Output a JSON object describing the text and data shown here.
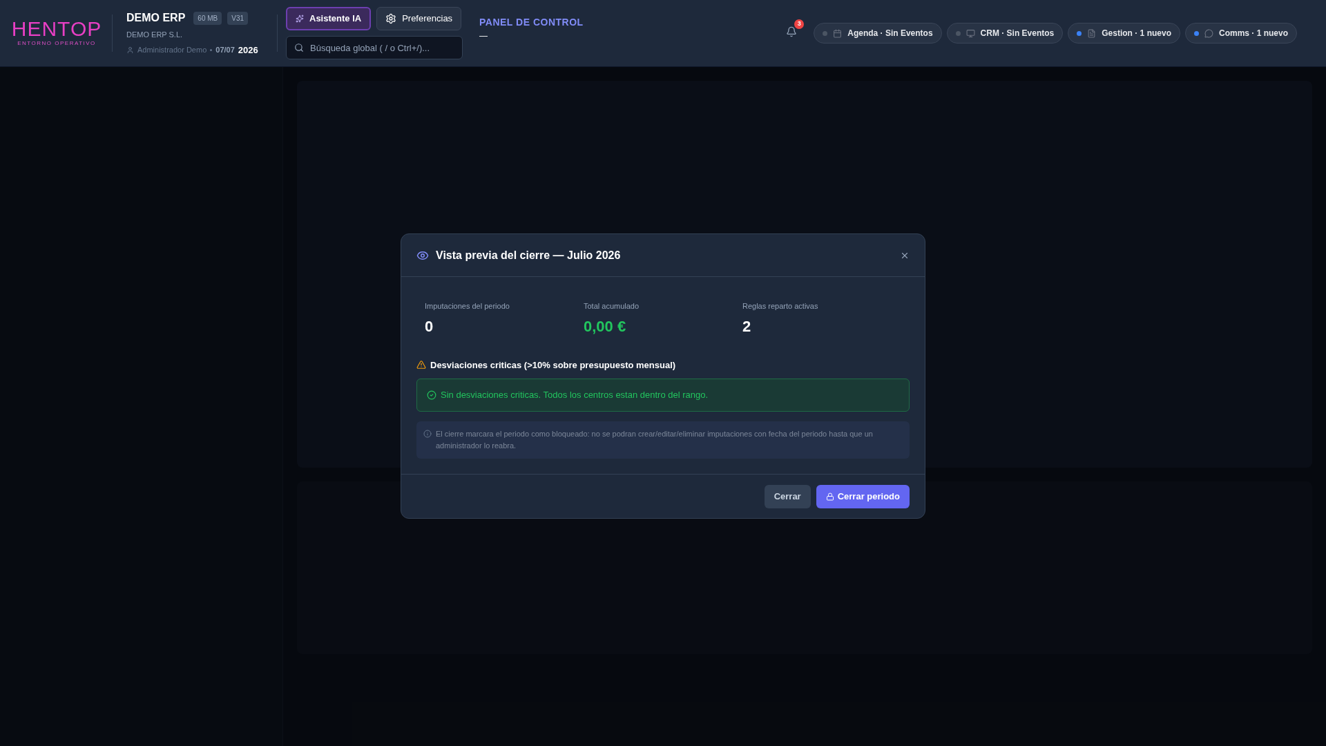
{
  "header": {
    "logo": {
      "name": "HENTOP",
      "tagline": "ENTORNO OPERATIVO"
    },
    "company": {
      "title": "DEMO ERP",
      "badges": [
        "60 MB",
        "V31"
      ],
      "subtitle": "DEMO ERP S.L.",
      "user": "Administrador Demo",
      "date": "07/07",
      "year": "2026"
    },
    "assistant_button": "Asistente IA",
    "preferences_button": "Preferencias",
    "search": {
      "placeholder": "Búsqueda global ( / o Ctrl+/)..."
    },
    "panel_title": "PANEL DE CONTROL",
    "panel_subtitle": "—",
    "notifications": {
      "count": "3"
    },
    "chips": [
      {
        "kind": "calendar",
        "label": "Agenda · Sin Eventos",
        "color": "#4b5563"
      },
      {
        "kind": "monitor",
        "label": "CRM · Sin Eventos",
        "color": "#4b5563"
      },
      {
        "kind": "file",
        "label": "Gestion · 1 nuevo",
        "color": "#3b82f6"
      },
      {
        "kind": "chat",
        "label": "Comms · 1 nuevo",
        "color": "#3b82f6"
      }
    ]
  },
  "dialog": {
    "title": "Vista previa del cierre — Julio 2026",
    "stats": [
      {
        "label": "Imputaciones del periodo",
        "value": "0",
        "kind": "plain"
      },
      {
        "label": "Total acumulado",
        "value": "0,00 €",
        "kind": "money"
      },
      {
        "label": "Reglas reparto activas",
        "value": "2",
        "kind": "plain"
      }
    ],
    "warning_heading": "Desviaciones criticas (>10% sobre presupuesto mensual)",
    "success_message": "Sin desviaciones criticas. Todos los centros estan dentro del rango.",
    "info_note": "El cierre marcara el periodo como bloqueado: no se podran crear/editar/eliminar imputaciones con fecha del periodo hasta que un administrador lo reabra.",
    "buttons": [
      {
        "label": "Cerrar",
        "kind": "secondary"
      },
      {
        "label": "Cerrar periodo",
        "kind": "primary"
      }
    ]
  }
}
